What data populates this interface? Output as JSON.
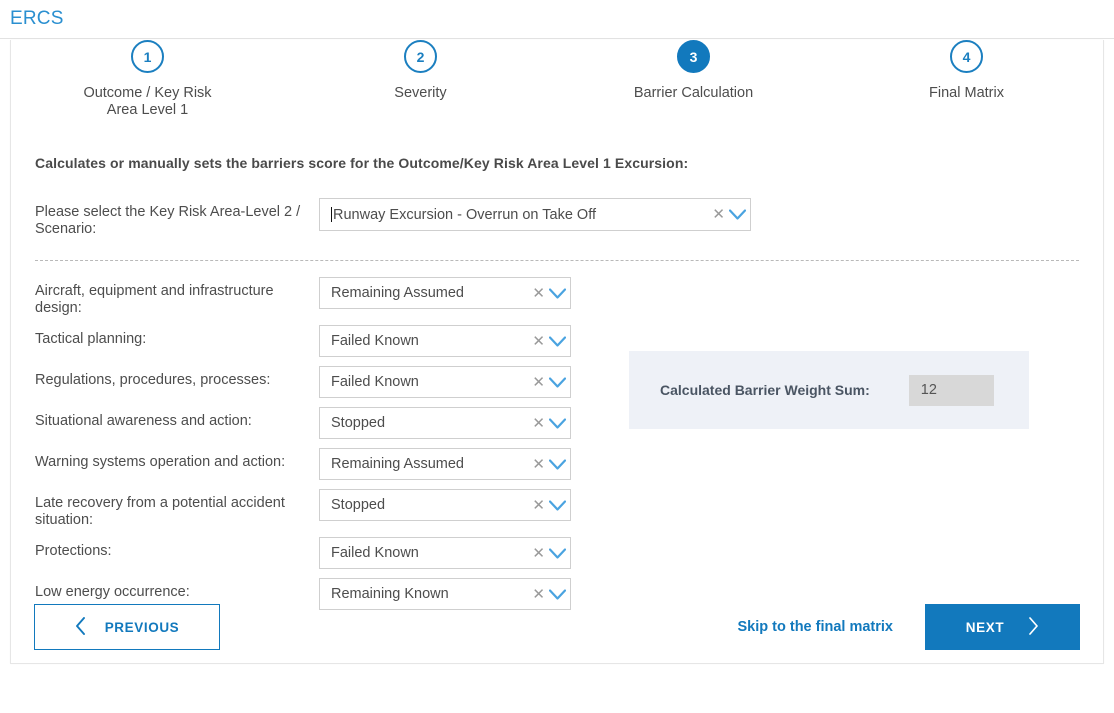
{
  "header": {
    "app_title": "ERCS"
  },
  "stepper": {
    "steps": [
      {
        "number": "1",
        "label": "Outcome / Key Risk\nArea Level 1",
        "active": false
      },
      {
        "number": "2",
        "label": "Severity",
        "active": false
      },
      {
        "number": "3",
        "label": "Barrier Calculation",
        "active": true
      },
      {
        "number": "4",
        "label": "Final Matrix",
        "active": false
      }
    ]
  },
  "main": {
    "intro_text": "Calculates or manually sets the barriers score for the Outcome/Key Risk Area Level 1 Excursion:",
    "scenario": {
      "label": "Please select the Key Risk Area-Level 2 / Scenario:",
      "value": "Runway Excursion - Overrun on Take Off",
      "clear_icon": "clear-icon",
      "chevron_icon": "chevron-down-icon",
      "has_caret": true
    },
    "barriers": [
      {
        "label": "Aircraft, equipment and infrastructure design:",
        "value": "Remaining Assumed"
      },
      {
        "label": "Tactical planning:",
        "value": "Failed Known"
      },
      {
        "label": "Regulations, procedures, processes:",
        "value": "Failed Known"
      },
      {
        "label": "Situational awareness and action:",
        "value": "Stopped"
      },
      {
        "label": "Warning systems operation and action:",
        "value": "Remaining Assumed"
      },
      {
        "label": "Late recovery from a potential accident situation:",
        "value": "Stopped"
      },
      {
        "label": "Protections:",
        "value": "Failed Known"
      },
      {
        "label": "Low energy occurrence:",
        "value": "Remaining Known"
      }
    ],
    "summary": {
      "label": "Calculated Barrier Weight Sum:",
      "value": "12"
    }
  },
  "footer": {
    "previous_label": "PREVIOUS",
    "previous_icon": "chevron-left-icon",
    "skip_label": "Skip to the final matrix",
    "next_label": "NEXT",
    "next_icon": "chevron-right-icon"
  },
  "colors": {
    "accent": "#1279bd",
    "title": "#2a8fd0",
    "panel_bg": "#eef1f7",
    "disabled_field": "#d8d8d8"
  }
}
